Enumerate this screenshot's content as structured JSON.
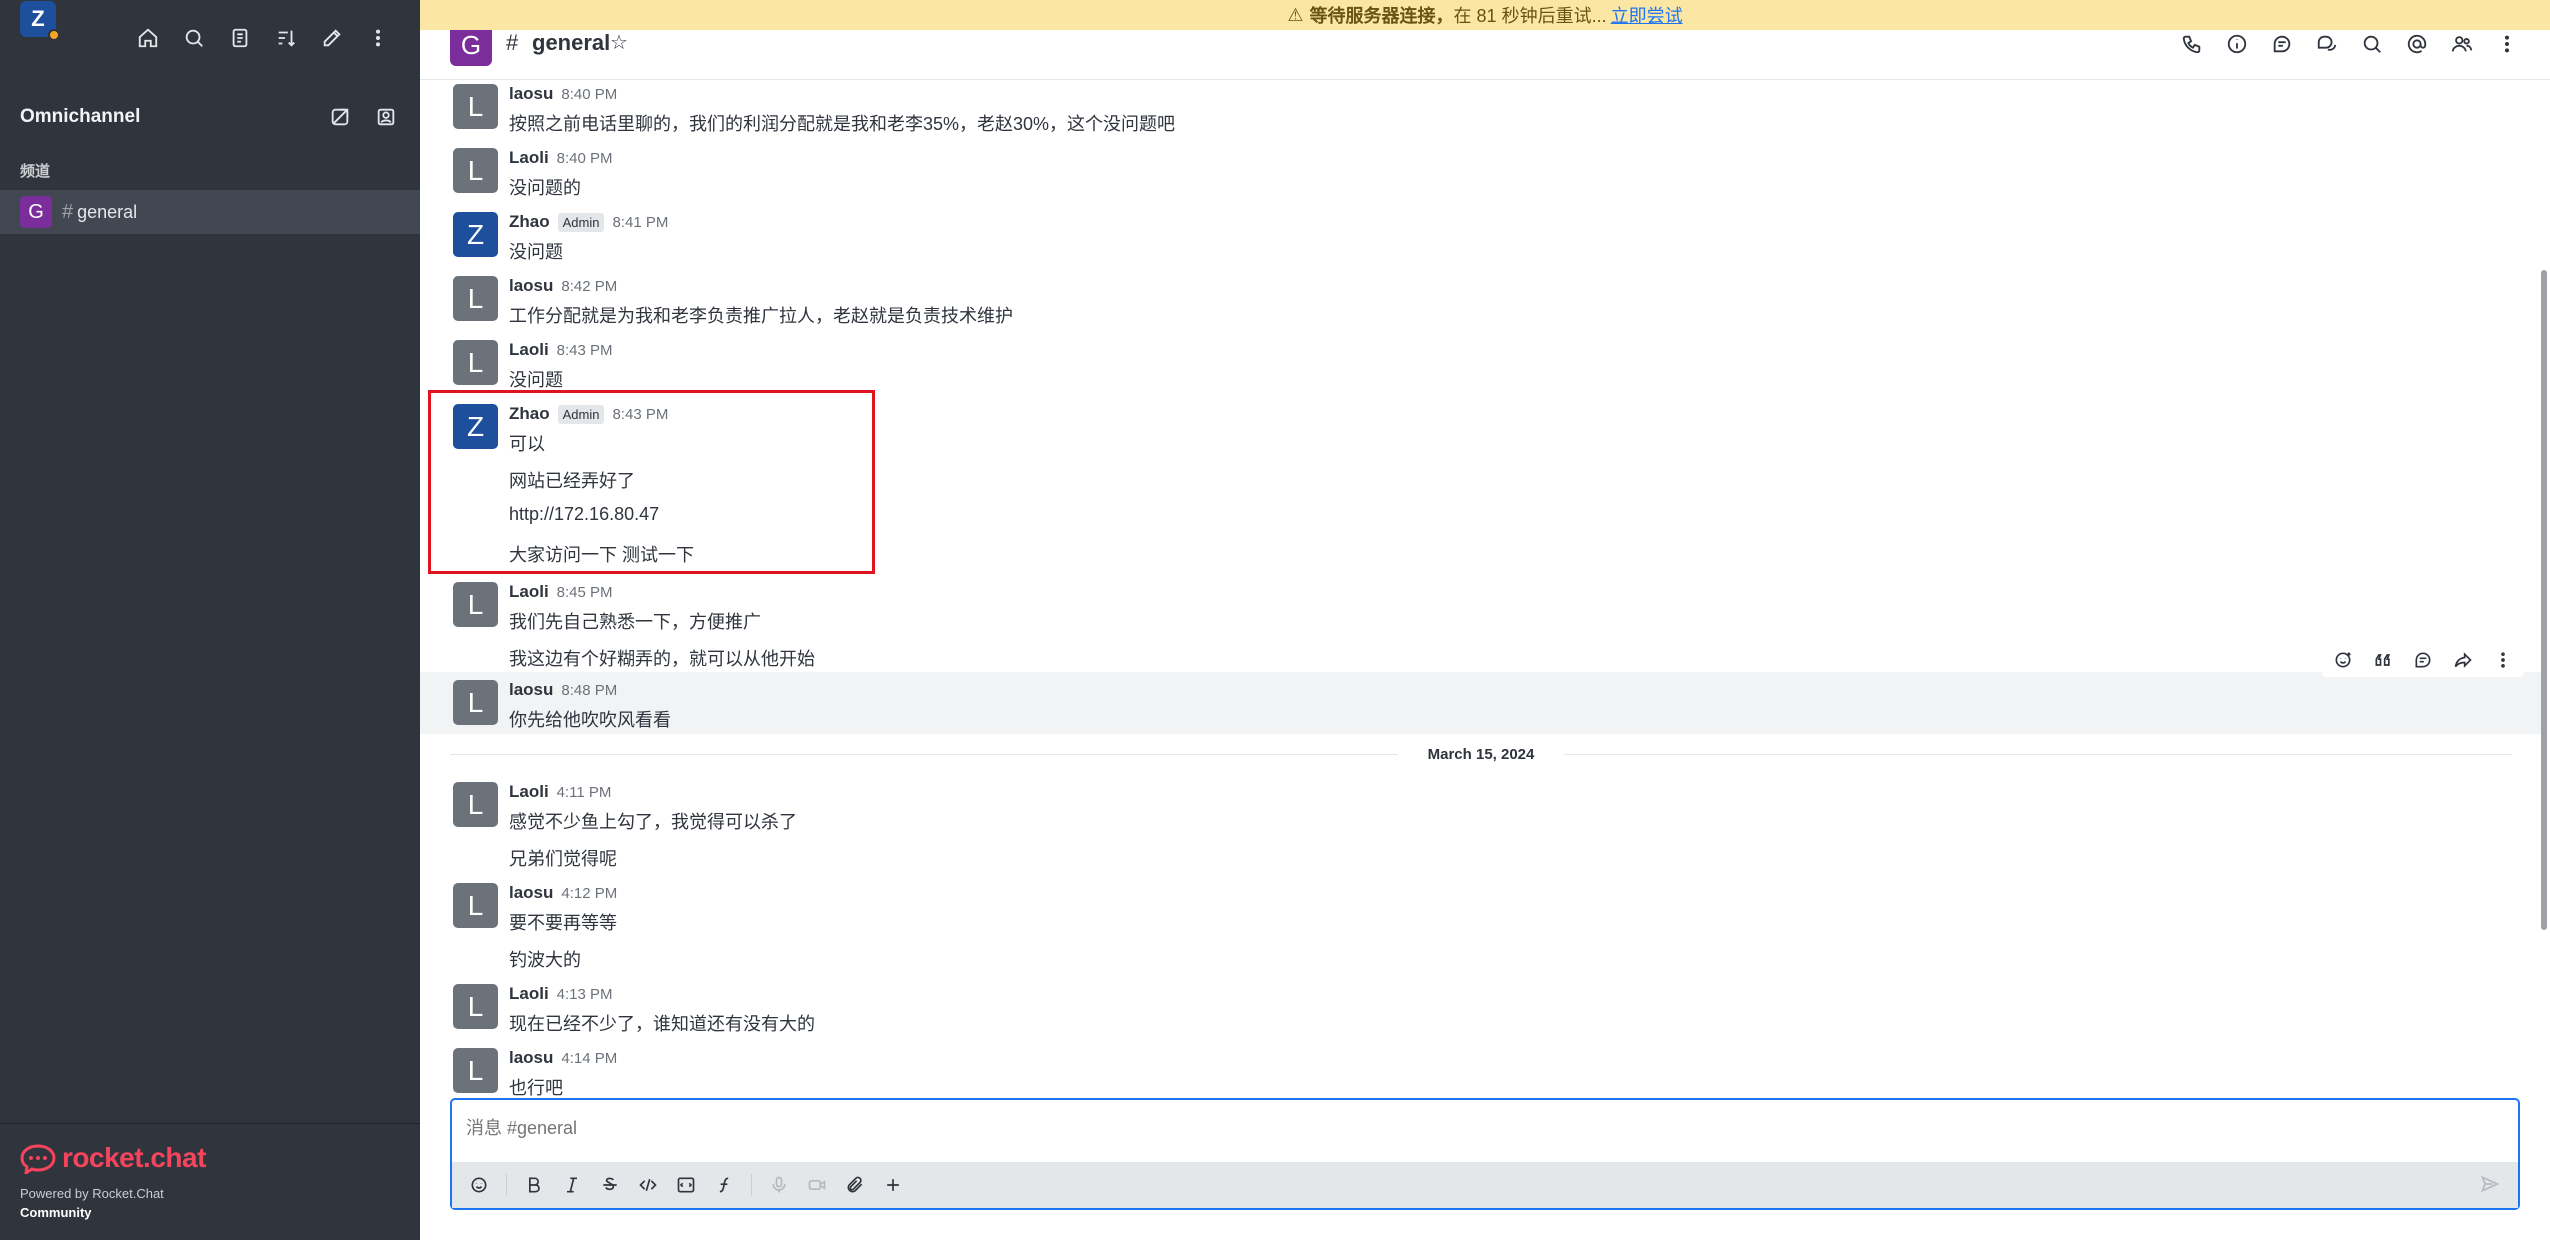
{
  "banner": {
    "prefix": "等待服务器连接，",
    "message": "在 81 秒钟后重试...",
    "retry_link": "立即尝试"
  },
  "sidebar": {
    "user_avatar": "Z",
    "section_title": "Omnichannel",
    "channels_heading": "频道",
    "room": {
      "avatar": "G",
      "name": "general"
    },
    "footer": {
      "logo_text": "rocket.chat",
      "powered_by": "Powered by Rocket.Chat",
      "edition": "Community"
    }
  },
  "header": {
    "avatar": "G",
    "hash": "#",
    "title": "general",
    "star": "☆"
  },
  "messages": [
    {
      "avatar": "L",
      "user": "laosu",
      "time": "8:40 PM",
      "lines": [
        "按照之前电话里聊的，我们的利润分配就是我和老李35%，老赵30%，这个没问题吧"
      ]
    },
    {
      "avatar": "L",
      "user": "Laoli",
      "time": "8:40 PM",
      "lines": [
        "没问题的"
      ]
    },
    {
      "avatar": "Z",
      "user": "Zhao",
      "badge": "Admin",
      "time": "8:41 PM",
      "lines": [
        "没问题"
      ]
    },
    {
      "avatar": "L",
      "user": "laosu",
      "time": "8:42 PM",
      "lines": [
        "工作分配就是为我和老李负责推广拉人，老赵就是负责技术维护"
      ]
    },
    {
      "avatar": "L",
      "user": "Laoli",
      "time": "8:43 PM",
      "lines": [
        "没问题"
      ]
    },
    {
      "avatar": "Z",
      "user": "Zhao",
      "badge": "Admin",
      "time": "8:43 PM",
      "lines": [
        "可以",
        "网站已经弄好了",
        "http://172.16.80.47",
        "大家访问一下 测试一下"
      ]
    },
    {
      "avatar": "L",
      "user": "Laoli",
      "time": "8:45 PM",
      "lines": [
        "我们先自己熟悉一下，方便推广",
        "我这边有个好糊弄的，就可以从他开始"
      ]
    },
    {
      "avatar": "L",
      "user": "laosu",
      "time": "8:48 PM",
      "lines": [
        "你先给他吹吹风看看"
      ]
    },
    {
      "avatar": "L",
      "user": "Laoli",
      "time": "4:11 PM",
      "lines": [
        "感觉不少鱼上勾了，我觉得可以杀了",
        "兄弟们觉得呢"
      ]
    },
    {
      "avatar": "L",
      "user": "laosu",
      "time": "4:12 PM",
      "lines": [
        "要不要再等等",
        "钓波大的"
      ]
    },
    {
      "avatar": "L",
      "user": "Laoli",
      "time": "4:13 PM",
      "lines": [
        "现在已经不少了，谁知道还有没有大的"
      ]
    },
    {
      "avatar": "L",
      "user": "laosu",
      "time": "4:14 PM",
      "lines": [
        "也行吧"
      ]
    }
  ],
  "date_divider": "March 15, 2024",
  "composer": {
    "placeholder": "消息 #general"
  }
}
